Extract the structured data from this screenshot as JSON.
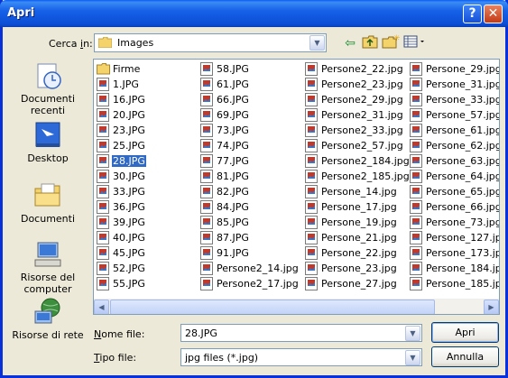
{
  "window": {
    "title": "Apri",
    "help_label": "?",
    "close_label": "✕"
  },
  "lookin": {
    "label_pre": "Cerca ",
    "label_u": "i",
    "label_post": "n:",
    "value": "Images"
  },
  "places": [
    {
      "label": "Documenti recenti",
      "icon": "recent-documents-icon"
    },
    {
      "label": "Desktop",
      "icon": "desktop-icon"
    },
    {
      "label": "Documenti",
      "icon": "my-documents-icon"
    },
    {
      "label": "Risorse del computer",
      "icon": "my-computer-icon"
    },
    {
      "label": "Risorse di rete",
      "icon": "network-places-icon"
    }
  ],
  "files": {
    "col1": [
      {
        "name": "Firme",
        "type": "folder"
      },
      {
        "name": "1.JPG",
        "type": "image"
      },
      {
        "name": "16.JPG",
        "type": "image"
      },
      {
        "name": "20.JPG",
        "type": "image"
      },
      {
        "name": "23.JPG",
        "type": "image"
      },
      {
        "name": "25.JPG",
        "type": "image"
      },
      {
        "name": "28.JPG",
        "type": "image",
        "selected": true
      },
      {
        "name": "30.JPG",
        "type": "image"
      },
      {
        "name": "33.JPG",
        "type": "image"
      },
      {
        "name": "36.JPG",
        "type": "image"
      },
      {
        "name": "39.JPG",
        "type": "image"
      },
      {
        "name": "40.JPG",
        "type": "image"
      },
      {
        "name": "45.JPG",
        "type": "image"
      },
      {
        "name": "52.JPG",
        "type": "image"
      },
      {
        "name": "55.JPG",
        "type": "image"
      }
    ],
    "col2": [
      {
        "name": "58.JPG",
        "type": "image"
      },
      {
        "name": "61.JPG",
        "type": "image"
      },
      {
        "name": "66.JPG",
        "type": "image"
      },
      {
        "name": "69.JPG",
        "type": "image"
      },
      {
        "name": "73.JPG",
        "type": "image"
      },
      {
        "name": "74.JPG",
        "type": "image"
      },
      {
        "name": "77.JPG",
        "type": "image"
      },
      {
        "name": "81.JPG",
        "type": "image"
      },
      {
        "name": "82.JPG",
        "type": "image"
      },
      {
        "name": "84.JPG",
        "type": "image"
      },
      {
        "name": "85.JPG",
        "type": "image"
      },
      {
        "name": "87.JPG",
        "type": "image"
      },
      {
        "name": "91.JPG",
        "type": "image"
      },
      {
        "name": "Persone2_14.jpg",
        "type": "image"
      },
      {
        "name": "Persone2_17.jpg",
        "type": "image"
      }
    ],
    "col3": [
      {
        "name": "Persone2_22.jpg",
        "type": "image"
      },
      {
        "name": "Persone2_23.jpg",
        "type": "image"
      },
      {
        "name": "Persone2_29.jpg",
        "type": "image"
      },
      {
        "name": "Persone2_31.jpg",
        "type": "image"
      },
      {
        "name": "Persone2_33.jpg",
        "type": "image"
      },
      {
        "name": "Persone2_57.jpg",
        "type": "image"
      },
      {
        "name": "Persone2_184.jpg",
        "type": "image"
      },
      {
        "name": "Persone2_185.jpg",
        "type": "image"
      },
      {
        "name": "Persone_14.jpg",
        "type": "image"
      },
      {
        "name": "Persone_17.jpg",
        "type": "image"
      },
      {
        "name": "Persone_19.jpg",
        "type": "image"
      },
      {
        "name": "Persone_21.jpg",
        "type": "image"
      },
      {
        "name": "Persone_22.jpg",
        "type": "image"
      },
      {
        "name": "Persone_23.jpg",
        "type": "image"
      },
      {
        "name": "Persone_27.jpg",
        "type": "image"
      }
    ],
    "col4": [
      {
        "name": "Persone_29.jpg",
        "type": "image"
      },
      {
        "name": "Persone_31.jpg",
        "type": "image"
      },
      {
        "name": "Persone_33.jpg",
        "type": "image"
      },
      {
        "name": "Persone_57.jpg",
        "type": "image"
      },
      {
        "name": "Persone_61.jpg",
        "type": "image"
      },
      {
        "name": "Persone_62.jpg",
        "type": "image"
      },
      {
        "name": "Persone_63.jpg",
        "type": "image"
      },
      {
        "name": "Persone_64.jpg",
        "type": "image"
      },
      {
        "name": "Persone_65.jpg",
        "type": "image"
      },
      {
        "name": "Persone_66.jpg",
        "type": "image"
      },
      {
        "name": "Persone_73.jpg",
        "type": "image"
      },
      {
        "name": "Persone_127.jpg",
        "type": "image"
      },
      {
        "name": "Persone_173.jpg",
        "type": "image"
      },
      {
        "name": "Persone_184.jpg",
        "type": "image"
      },
      {
        "name": "Persone_185.jpg",
        "type": "image"
      }
    ]
  },
  "filename": {
    "label_u": "N",
    "label_post": "ome file:",
    "value": "28.JPG"
  },
  "filetype": {
    "label_u": "T",
    "label_post": "ipo file:",
    "value": "jpg files (*.jpg)"
  },
  "buttons": {
    "open": "Apri",
    "cancel": "Annulla"
  },
  "colors": {
    "selection": "#316ac5",
    "titlebar": "#0c4fd6",
    "face": "#ece9d8"
  }
}
